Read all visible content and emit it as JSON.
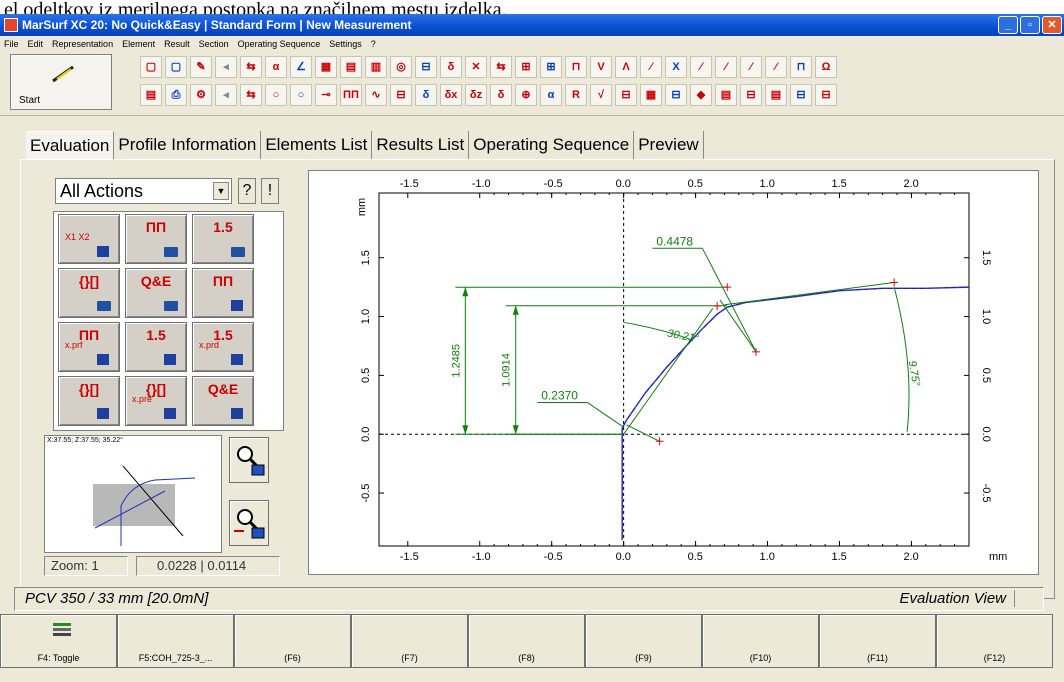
{
  "page_top_text": "el odeltkov iz merilnega postopka na značilnem mestu izdelka.",
  "window": {
    "title": "MarSurf XC 20: No Quick&Easy | Standard Form | New Measurement",
    "buttons": [
      "_",
      "▫",
      "✕"
    ]
  },
  "menu": [
    "File",
    "Edit",
    "Representation",
    "Element",
    "Result",
    "Section",
    "Operating Sequence",
    "Settings",
    "?"
  ],
  "toolbar": {
    "start_label": "Start",
    "row1": [
      "▢",
      "▢",
      "✎",
      "◂",
      "⇆",
      "α",
      "∠",
      "▦",
      "▤",
      "▥",
      "◎",
      "⊟",
      "δ",
      "✕",
      "⇆",
      "⊞",
      "⊞",
      "⊓",
      "V",
      "Λ",
      "⁄",
      "X",
      "⁄",
      "⁄",
      "⁄",
      "⁄",
      "⊓",
      "Ω"
    ],
    "row2": [
      "▤",
      "⎙",
      "⚙",
      "◂",
      "⇆",
      "○",
      "○",
      "⊸",
      "ΠΠ",
      "∿",
      "⊟",
      "δ",
      "δx",
      "δz",
      "δ",
      "⊕",
      "α",
      "R",
      "√",
      "⊟",
      "▦",
      "⊟",
      "◆",
      "▤",
      "⊟",
      "▤",
      "⊟",
      "⊟"
    ]
  },
  "tabs": [
    "Evaluation",
    "Profile Information",
    "Elements List",
    "Results List",
    "Operating Sequence",
    "Preview"
  ],
  "actions": {
    "select_value": "All Actions",
    "help_buttons": [
      "?",
      "!"
    ],
    "buttons": [
      {
        "main": "",
        "sub": "X1  X2",
        "icon": "probe-icon"
      },
      {
        "main": "ΠΠ",
        "sub": "",
        "icon": "profile-open-icon"
      },
      {
        "main": "1.5",
        "sub": "",
        "icon": "roughness-open-icon"
      },
      {
        "main": "{}[]",
        "sub": "",
        "icon": "sequence-open-icon"
      },
      {
        "main": "Q&E",
        "sub": "",
        "icon": "quick-easy-open-icon"
      },
      {
        "main": "ΠΠ",
        "sub": "",
        "icon": "profile-save-icon"
      },
      {
        "main": "ΠΠ",
        "sub": "x.prf",
        "icon": "profile-save-as-icon"
      },
      {
        "main": "1.5",
        "sub": "",
        "icon": "roughness-save-icon"
      },
      {
        "main": "1.5",
        "sub": "x.prd",
        "icon": "roughness-save-as-icon"
      },
      {
        "main": "{}[]",
        "sub": "",
        "icon": "sequence-save-icon"
      },
      {
        "main": "{}[]",
        "sub": "x.pre",
        "icon": "sequence-save-as-icon"
      },
      {
        "main": "Q&E",
        "sub": "",
        "icon": "quick-easy-save-icon"
      }
    ]
  },
  "preview": {
    "coord_text": "X:37.55; Z:37.55; 35.22°",
    "zoom_label": "Zoom: 1",
    "scale_value": "0.0228 | 0.0114"
  },
  "status": {
    "left": "PCV 350 / 33 mm [20.0mN]",
    "right": "Evaluation View"
  },
  "fkeys": [
    "F4: Toggle",
    "F5:COH_725-3_...",
    "(F6)",
    "(F7)",
    "(F8)",
    "(F9)",
    "(F10)",
    "(F11)",
    "(F12)"
  ],
  "chart_data": {
    "type": "line",
    "x_unit": "mm",
    "y_unit": "mm",
    "x_ticks": [
      -1.5,
      -1.0,
      -0.5,
      0.0,
      0.5,
      1.0,
      1.5,
      2.0
    ],
    "y_ticks": [
      -0.5,
      0.0,
      0.5,
      1.0,
      1.5
    ],
    "xlim": [
      -1.7,
      2.4
    ],
    "ylim": [
      -0.95,
      2.05
    ],
    "profile": [
      {
        "x": -0.01,
        "y": -0.9
      },
      {
        "x": -0.01,
        "y": -0.3
      },
      {
        "x": -0.01,
        "y": 0.05
      },
      {
        "x": 0.02,
        "y": 0.12
      },
      {
        "x": 0.15,
        "y": 0.35
      },
      {
        "x": 0.3,
        "y": 0.57
      },
      {
        "x": 0.45,
        "y": 0.77
      },
      {
        "x": 0.55,
        "y": 0.9
      },
      {
        "x": 0.65,
        "y": 1.02
      },
      {
        "x": 0.72,
        "y": 1.08
      },
      {
        "x": 0.85,
        "y": 1.12
      },
      {
        "x": 1.2,
        "y": 1.17
      },
      {
        "x": 1.5,
        "y": 1.22
      },
      {
        "x": 1.8,
        "y": 1.24
      },
      {
        "x": 2.1,
        "y": 1.24
      },
      {
        "x": 2.4,
        "y": 1.25
      }
    ],
    "tangent_lines": [
      {
        "points": [
          {
            "x": 0.0,
            "y": 0.0
          },
          {
            "x": 0.62,
            "y": 1.07
          }
        ]
      },
      {
        "points": [
          {
            "x": 0.7,
            "y": 1.1
          },
          {
            "x": 1.88,
            "y": 1.29
          }
        ]
      },
      {
        "points": [
          {
            "x": 0.67,
            "y": 1.14
          },
          {
            "x": 0.92,
            "y": 0.7
          }
        ]
      },
      {
        "points": [
          {
            "x": 0.02,
            "y": 0.08
          },
          {
            "x": 0.25,
            "y": -0.06
          }
        ]
      }
    ],
    "markers": [
      {
        "x": 0.72,
        "y": 1.25
      },
      {
        "x": 0.65,
        "y": 1.09
      },
      {
        "x": 0.92,
        "y": 0.7
      },
      {
        "x": 0.25,
        "y": -0.06
      },
      {
        "x": 1.88,
        "y": 1.29
      }
    ],
    "dimensions": [
      {
        "label": "1.2485",
        "x": -1.1,
        "from": 0.0,
        "to": 1.2485
      },
      {
        "label": "1.0914",
        "x": -0.75,
        "from": 0.0,
        "to": 1.0914
      }
    ],
    "callouts": [
      {
        "label": "0.4478",
        "x": 0.2,
        "y": 1.58
      },
      {
        "label": "0.2370",
        "x": -0.6,
        "y": 0.27
      }
    ],
    "angles": [
      {
        "label": "30.21°",
        "x": 0.3,
        "y": 0.83
      },
      {
        "label": "9.75°",
        "x": 1.98,
        "y": 0.62
      }
    ]
  }
}
